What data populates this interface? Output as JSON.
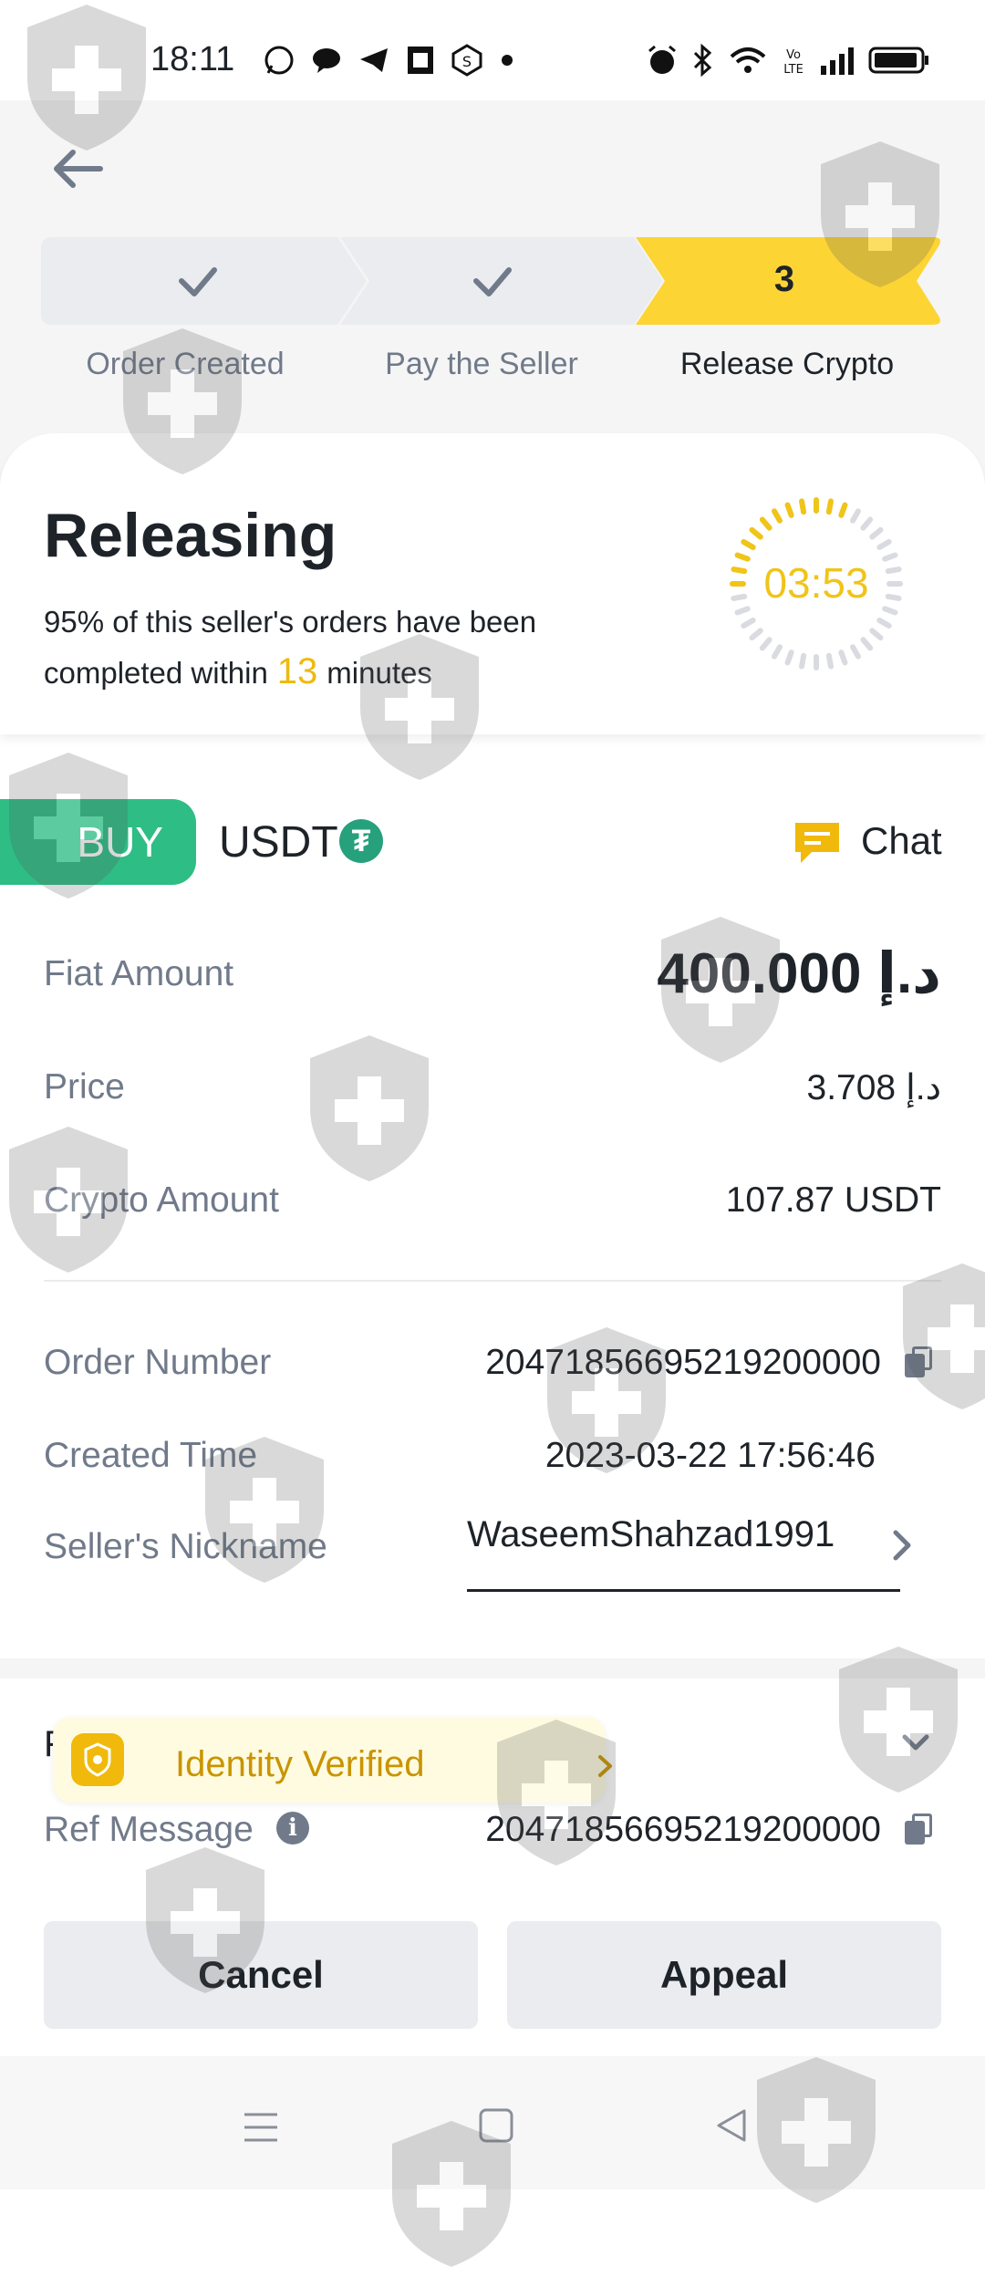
{
  "status_bar": {
    "time": "18:11"
  },
  "steps": [
    {
      "label": "Order Created",
      "state": "done"
    },
    {
      "label": "Pay the Seller",
      "state": "done"
    },
    {
      "label": "Release Crypto",
      "state": "current",
      "number": "3"
    }
  ],
  "status": {
    "title": "Releasing",
    "subtitle_prefix": "95% of this seller's orders have been completed within",
    "minutes": "13",
    "subtitle_suffix": "minutes",
    "timer": "03:53"
  },
  "trade": {
    "side": "BUY",
    "asset": "USDT",
    "asset_symbol": "₮",
    "chat_label": "Chat"
  },
  "amounts": [
    {
      "label": "Fiat Amount",
      "value": "400.000 د.إ"
    },
    {
      "label": "Price",
      "value": "3.708 د.إ"
    },
    {
      "label": "Crypto Amount",
      "value": "107.87 USDT"
    }
  ],
  "order": {
    "number_label": "Order Number",
    "number": "20471856695219200000",
    "created_label": "Created Time",
    "created": "2023-03-22 17:56:46",
    "nickname_label": "Seller's Nickname",
    "nickname": "WaseemShahzad1991"
  },
  "payment": {
    "partial_label": "F",
    "ref_label": "Ref Message",
    "ref_value": "20471856695219200000"
  },
  "toast": {
    "text": "Identity Verified"
  },
  "actions": {
    "cancel": "Cancel",
    "appeal": "Appeal"
  },
  "colors": {
    "accent": "#f0b90b",
    "buy": "#2ebd85",
    "text": "#1e2329",
    "muted": "#707a8a"
  }
}
